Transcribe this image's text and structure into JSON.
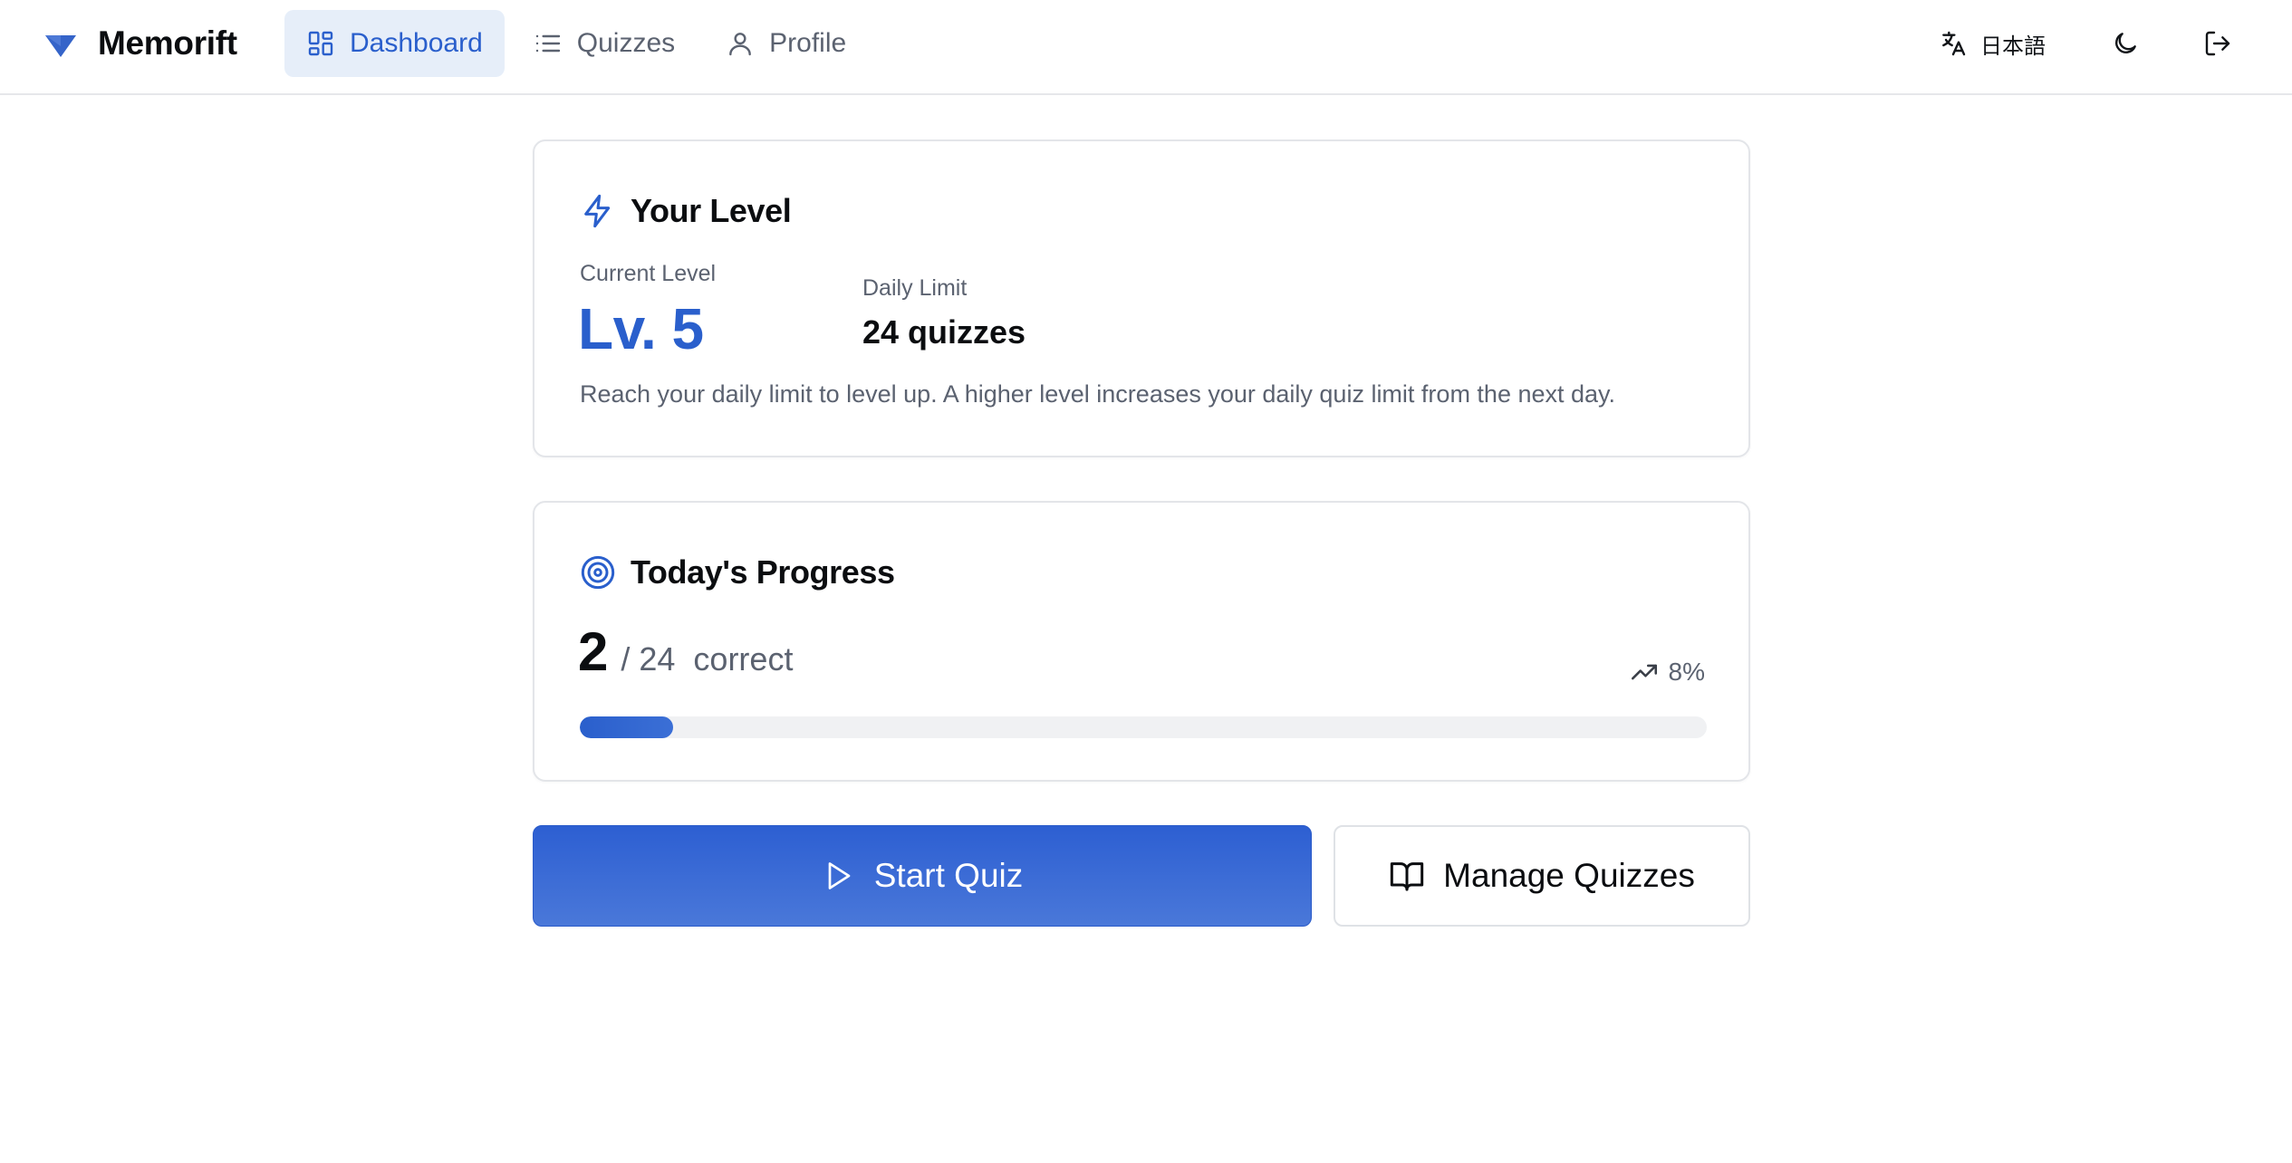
{
  "app": {
    "name": "Memorift",
    "brand_color": "#2a5fcc",
    "logo_icon": "triangle-down-icon"
  },
  "nav": {
    "items": [
      {
        "label": "Dashboard",
        "icon": "dashboard-grid-icon",
        "active": true
      },
      {
        "label": "Quizzes",
        "icon": "list-icon",
        "active": false
      },
      {
        "label": "Profile",
        "icon": "user-icon",
        "active": false
      }
    ]
  },
  "header_actions": {
    "language_label": "日本語",
    "language_icon": "translate-icon",
    "theme_icon": "moon-icon",
    "logout_icon": "logout-icon"
  },
  "level_card": {
    "title": "Your Level",
    "icon": "lightning-icon",
    "current_level_label": "Current Level",
    "current_level_value": "Lv. 5",
    "daily_limit_label": "Daily Limit",
    "daily_limit_value": "24 quizzes",
    "description": "Reach your daily limit to level up. A higher level increases your daily quiz limit from the next day."
  },
  "progress_card": {
    "title": "Today's Progress",
    "icon": "target-icon",
    "correct_count": "2",
    "total_text": "/ 24",
    "suffix": "correct",
    "percent_text": "8%",
    "percent_icon": "trending-up-icon",
    "fill_fraction": 0.083
  },
  "actions": {
    "start_label": "Start Quiz",
    "start_icon": "play-icon",
    "manage_label": "Manage Quizzes",
    "manage_icon": "book-open-icon"
  }
}
